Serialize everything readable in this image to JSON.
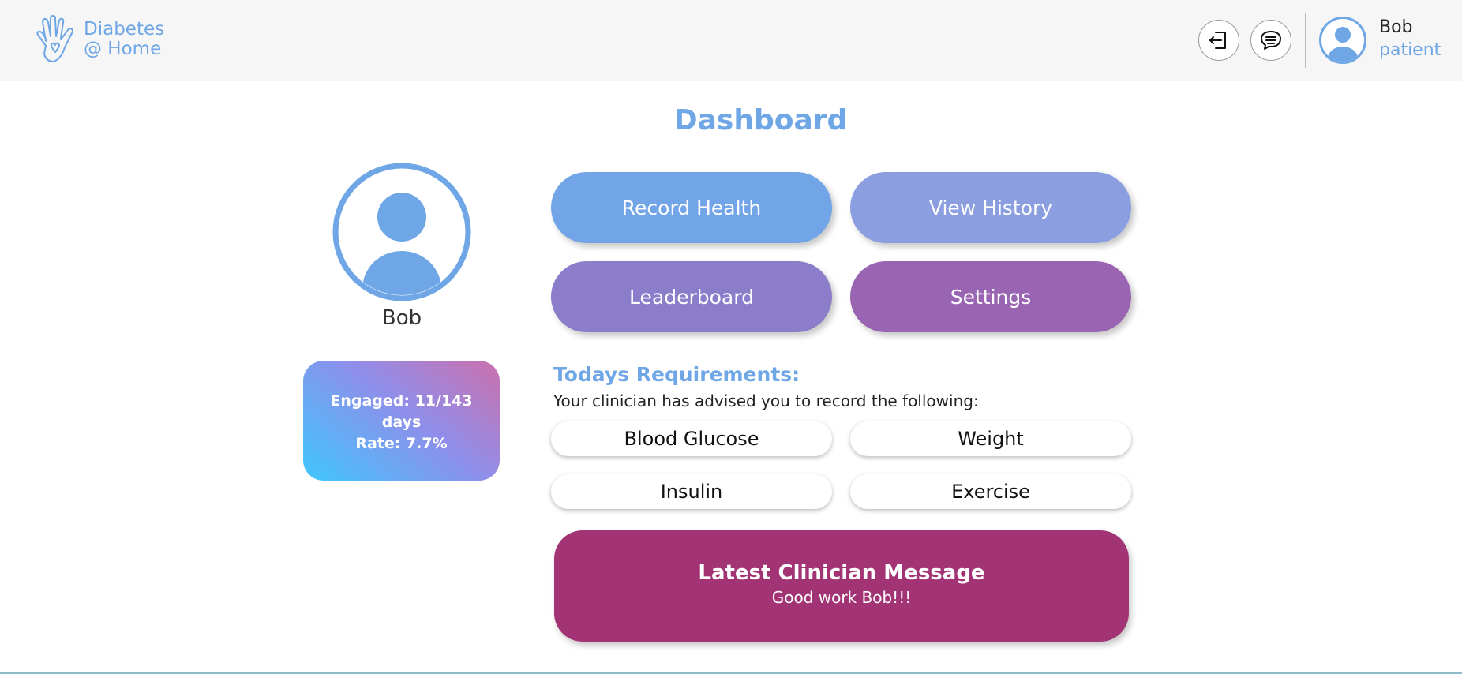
{
  "header": {
    "logo_line1": "Diabetes",
    "logo_line2": "@ Home",
    "logout_icon": "logout-icon",
    "messages_icon": "chat-bubble-icon",
    "user_name": "Bob",
    "user_role": "patient"
  },
  "page": {
    "title": "Dashboard"
  },
  "profile": {
    "name": "Bob",
    "engaged_line": "Engaged: 11/143",
    "days_line": "days",
    "rate_line": "Rate: 7.7%"
  },
  "nav": {
    "record_health": "Record Health",
    "view_history": "View History",
    "leaderboard": "Leaderboard",
    "settings": "Settings"
  },
  "requirements": {
    "title": "Todays Requirements:",
    "subtitle": "Your clinician has advised you to record the following:",
    "items": [
      "Blood Glucose",
      "Weight",
      "Insulin",
      "Exercise"
    ]
  },
  "message": {
    "title": "Latest Clinician Message",
    "text": "Good work Bob!!!"
  },
  "colors": {
    "accent_blue": "#6fa6e6",
    "record_health": "#72a5e8",
    "view_history": "#8b9ee0",
    "leaderboard": "#8b7dca",
    "settings": "#9965b2",
    "message_bg": "#a23374"
  }
}
